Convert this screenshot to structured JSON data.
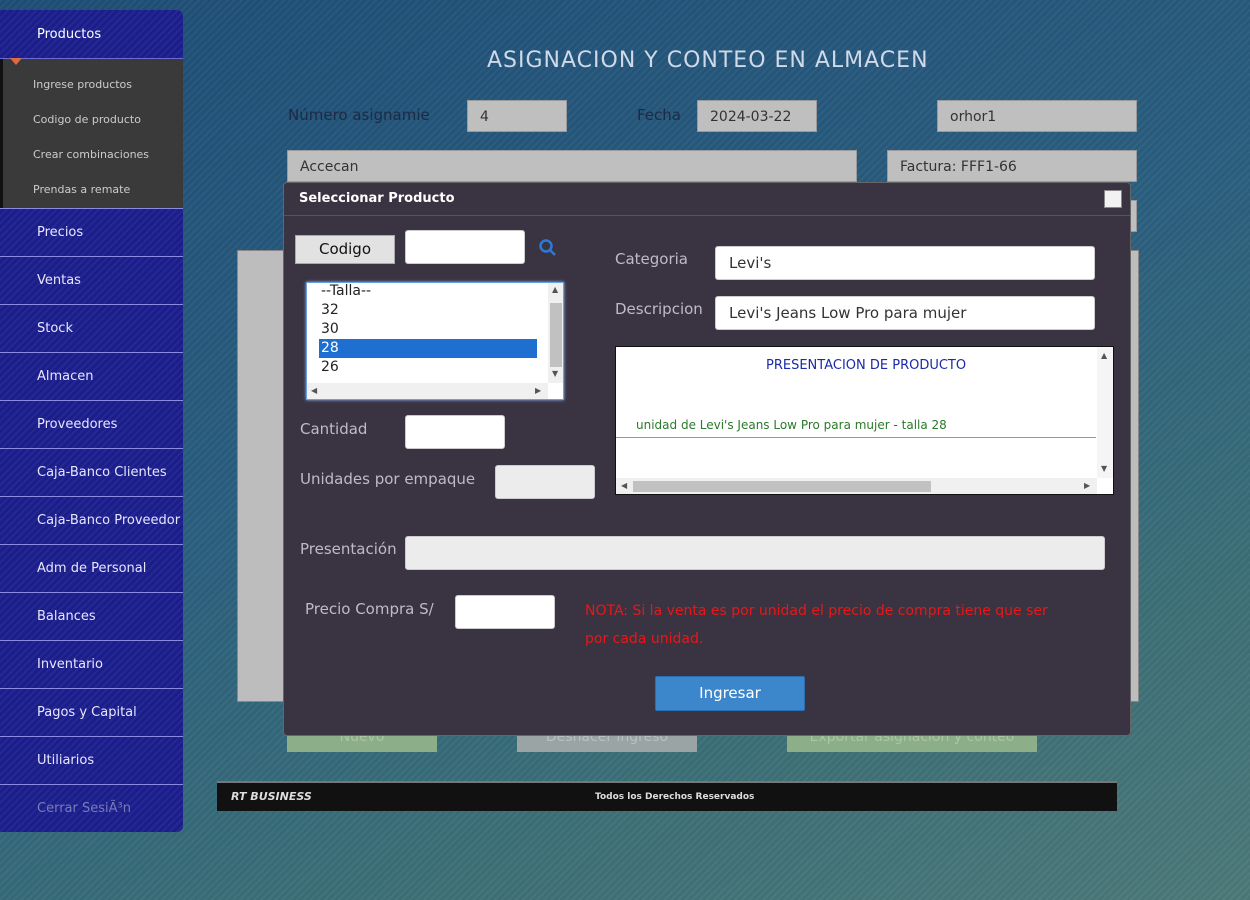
{
  "sidebar": {
    "header": "Productos",
    "submenu": [
      "Ingrese productos",
      "Codigo de producto",
      "Crear combinaciones",
      "Prendas a remate"
    ],
    "items": [
      "Precios",
      "Ventas",
      "Stock",
      "Almacen",
      "Proveedores",
      "Caja-Banco Clientes",
      "Caja-Banco Proveedor",
      "Adm de Personal",
      "Balances",
      "Inventario",
      "Pagos y Capital",
      "Utiliarios"
    ],
    "logout": "Cerrar SesiÃ³n"
  },
  "page": {
    "title": "ASIGNACION Y CONTEO EN ALMACEN",
    "numero_label": "Número asignamie",
    "numero_value": "4",
    "fecha_label": "Fecha",
    "fecha_value": "2024-03-22",
    "user_value": "orhor1",
    "proveedor_value": "Accecan",
    "factura_value": "Factura: FFF1-66",
    "buttons": {
      "nuevo": "Nuevo",
      "deshacer": "Deshacer ingreso",
      "exportar": "Exportar asignación y conteo"
    }
  },
  "footer": {
    "brand": "RT BUSINESS",
    "rights": "Todos los Derechos Reservados"
  },
  "modal": {
    "title": "Seleccionar Producto",
    "codigo_button": "Codigo",
    "codigo_value": "",
    "talla_options": [
      "--Talla--",
      "32",
      "30",
      "28",
      "26"
    ],
    "talla_selected": "28",
    "cantidad_label": "Cantidad",
    "cantidad_value": "",
    "unidades_label": "Unidades por empaque",
    "unidades_value": "",
    "categoria_label": "Categoria",
    "categoria_value": "Levi's",
    "descripcion_label": "Descripcion",
    "descripcion_value": "Levi's Jeans Low Pro para mujer",
    "presentacion_title": "PRESENTACION DE PRODUCTO",
    "presentacion_line": "unidad de Levi's Jeans Low Pro para mujer - talla 28",
    "presentacion_label": "Presentación",
    "presentacion_value": "",
    "precio_label": "Precio Compra S/",
    "precio_value": "",
    "nota_line1": "NOTA: Si la venta es por unidad el precio de compra tiene que ser",
    "nota_line2": "por cada unidad.",
    "ingresar_button": "Ingresar"
  },
  "colors": {
    "sidebar": "#1c1f8f",
    "modal": "#3a3342",
    "accent": "#3c86cc",
    "nota": "#e81818",
    "selected": "#1e6fd0"
  }
}
